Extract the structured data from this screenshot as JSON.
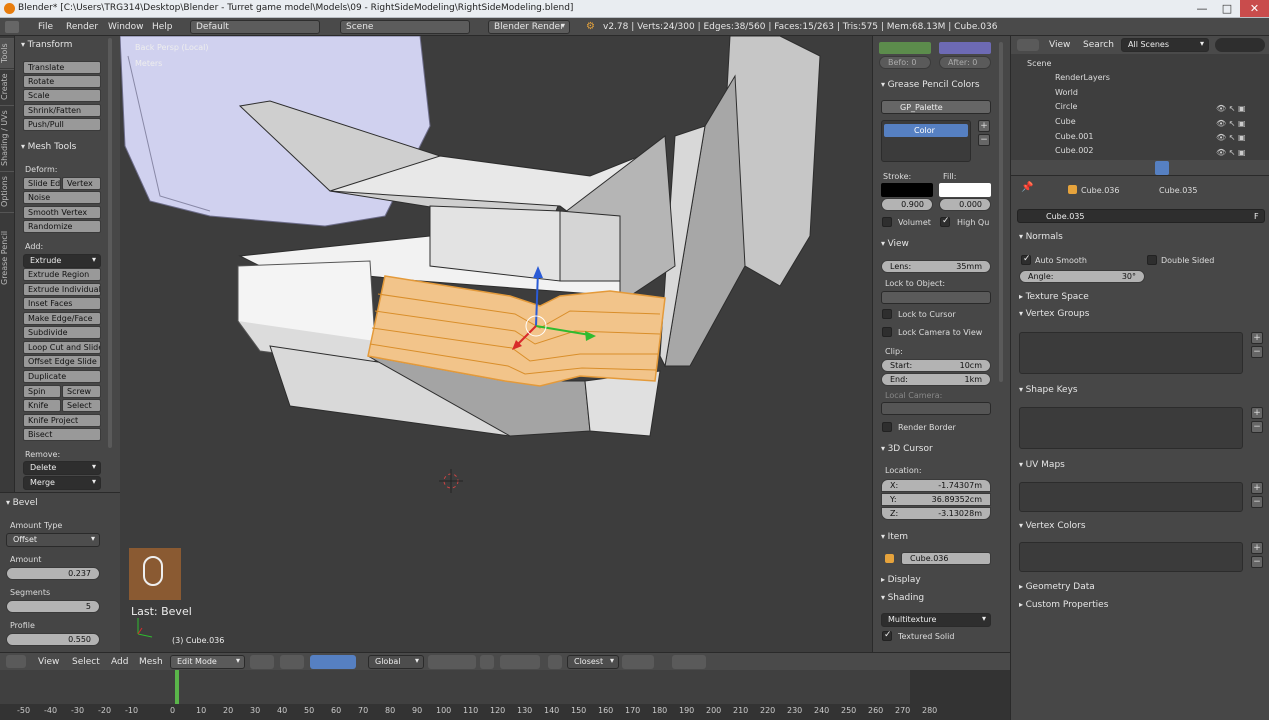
{
  "titlebar": {
    "title": "Blender* [C:\\Users\\TRG314\\Desktop\\Blender - Turret game model\\Models\\09 - RightSideModeling\\RightSideModeling.blend]",
    "min": "—",
    "max": "□",
    "close": "✕"
  },
  "infobar": {
    "menus": [
      "File",
      "Render",
      "Window",
      "Help"
    ],
    "layout": "Default",
    "scene": "Scene",
    "engine": "Blender Render",
    "stats": "v2.78 | Verts:24/300 | Edges:38/560 | Faces:15/263 | Tris:575 | Mem:68.13M | Cube.036"
  },
  "tool_tabs": [
    "Tools",
    "Create",
    "Shading / UVs",
    "Options",
    "Grease Pencil"
  ],
  "toolshelf": {
    "transform_title": "Transform",
    "transform": [
      "Translate",
      "Rotate",
      "Scale",
      "Shrink/Fatten",
      "Push/Pull"
    ],
    "meshtools_title": "Mesh Tools",
    "deform_label": "Deform:",
    "slide_edge": "Slide Ed",
    "vertex": "Vertex",
    "noise": "Noise",
    "smooth_vertex": "Smooth Vertex",
    "randomize": "Randomize",
    "add_label": "Add:",
    "extrude": "Extrude",
    "add_tools": [
      "Extrude Region",
      "Extrude Individual",
      "Inset Faces",
      "Make Edge/Face",
      "Subdivide",
      "Loop Cut and Slide",
      "Offset Edge Slide",
      "Duplicate"
    ],
    "spin": "Spin",
    "screw": "Screw",
    "knife": "Knife",
    "select": "Select",
    "knife_project": "Knife Project",
    "bisect": "Bisect",
    "remove_label": "Remove:",
    "delete": "Delete",
    "merge": "Merge"
  },
  "operator": {
    "title": "Bevel",
    "amount_type_label": "Amount Type",
    "amount_type": "Offset",
    "amount_label": "Amount",
    "amount": "0.237",
    "segments_label": "Segments",
    "segments": "5",
    "profile_label": "Profile",
    "profile": "0.550"
  },
  "viewport": {
    "view_name": "Back Persp (Local)",
    "units": "Meters",
    "last_op": "Last: Bevel",
    "object_info": "(3) Cube.036"
  },
  "viewport_header": {
    "menus": [
      "View",
      "Select",
      "Add",
      "Mesh"
    ],
    "mode": "Edit Mode",
    "orientation": "Global",
    "snap": "Closest"
  },
  "npanel": {
    "before": "Befo: 0",
    "after": "After: 0",
    "gp_colors_title": "Grease Pencil Colors",
    "palette": "GP_Palette",
    "color_slot": "Color",
    "stroke_label": "Stroke:",
    "fill_label": "Fill:",
    "stroke_val": "0.900",
    "fill_val": "0.000",
    "volumet": "Volumet",
    "high_qu": "High Qu",
    "view_title": "View",
    "lens_label": "Lens:",
    "lens": "35mm",
    "lock_to_object": "Lock to Object:",
    "lock_to_cursor": "Lock to Cursor",
    "lock_camera": "Lock Camera to View",
    "clip_label": "Clip:",
    "start_label": "Start:",
    "start": "10cm",
    "end_label": "End:",
    "end": "1km",
    "local_camera": "Local Camera:",
    "render_border": "Render Border",
    "cursor_title": "3D Cursor",
    "location_label": "Location:",
    "x_label": "X:",
    "x": "-1.74307m",
    "y_label": "Y:",
    "y": "36.89352cm",
    "z_label": "Z:",
    "z": "-3.13028m",
    "item_title": "Item",
    "item_name": "Cube.036",
    "display_title": "Display",
    "shading_title": "Shading",
    "shading_mode": "Multitexture",
    "textured_solid": "Textured Solid"
  },
  "outliner": {
    "menus": [
      "View",
      "Search"
    ],
    "filter": "All Scenes",
    "items": [
      "Scene",
      "RenderLayers",
      "World",
      "Circle",
      "Cube",
      "Cube.001",
      "Cube.002"
    ]
  },
  "properties": {
    "breadcrumb_obj": "Cube.036",
    "breadcrumb_mesh": "Cube.035",
    "mesh_name": "Cube.035",
    "fake_user": "F",
    "normals_title": "Normals",
    "auto_smooth": "Auto Smooth",
    "double_sided": "Double Sided",
    "angle_label": "Angle:",
    "angle": "30°",
    "texture_space": "Texture Space",
    "vertex_groups": "Vertex Groups",
    "shape_keys": "Shape Keys",
    "uv_maps": "UV Maps",
    "vertex_colors": "Vertex Colors",
    "geometry_data": "Geometry Data",
    "custom_properties": "Custom Properties"
  },
  "timeline": {
    "ticks": [
      "-50",
      "-40",
      "-30",
      "-20",
      "-10",
      "0",
      "10",
      "20",
      "30",
      "40",
      "50",
      "60",
      "70",
      "80",
      "90",
      "100",
      "110",
      "120",
      "130",
      "140",
      "150",
      "160",
      "170",
      "180",
      "190",
      "200",
      "210",
      "220",
      "230",
      "240",
      "250",
      "260",
      "270",
      "280"
    ]
  },
  "colors": {
    "selection": "#f2a44a",
    "accent": "#5680c2",
    "mesh": "#c9c9c9"
  }
}
